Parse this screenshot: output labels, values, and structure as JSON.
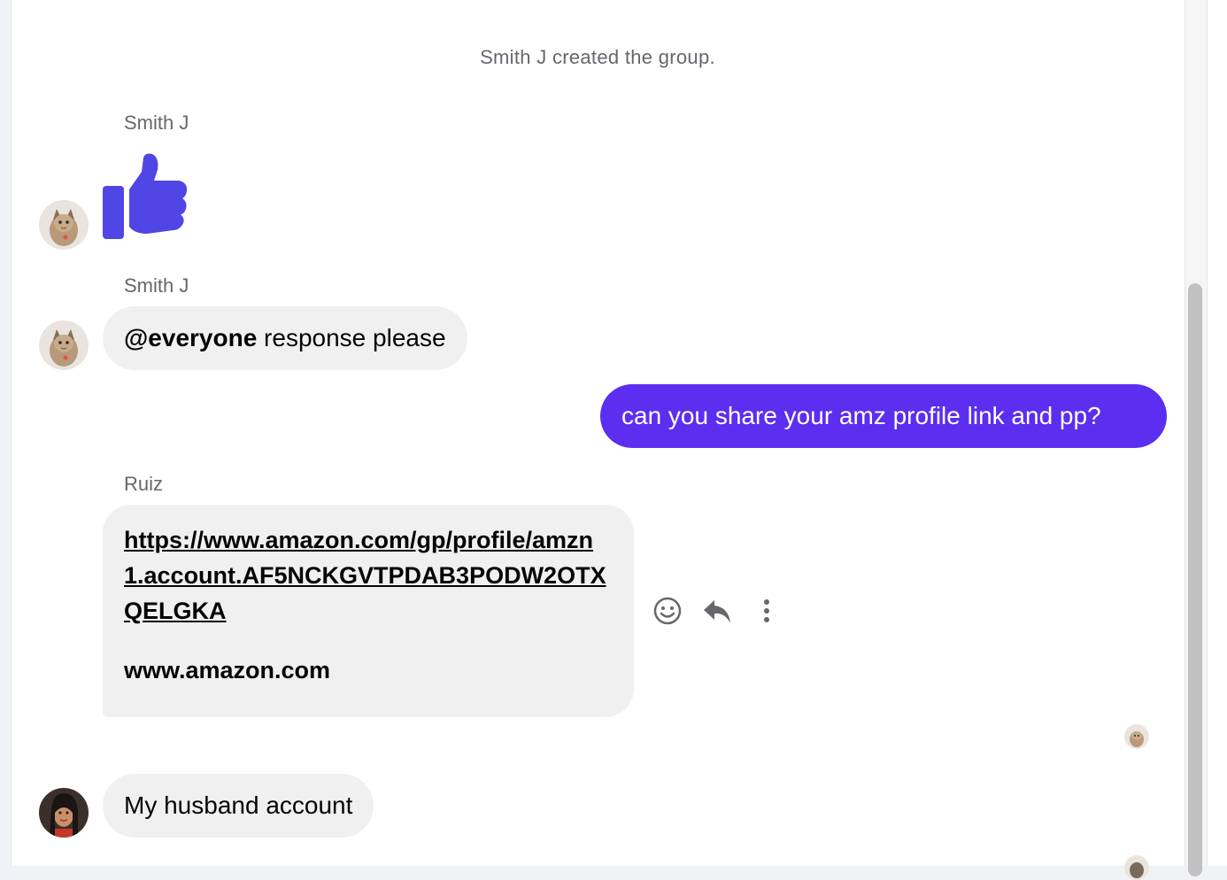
{
  "conversation": {
    "system_message": "Smith J created the group.",
    "messages": [
      {
        "sender": "Smith J",
        "type": "like-sticker"
      },
      {
        "sender": "Smith J",
        "mention": "@everyone",
        "text": " response please"
      },
      {
        "sender": "me",
        "text": "can you share your amz profile link and pp?"
      },
      {
        "sender": "Ruiz",
        "link": "https://www.amazon.com/gp/profile/amzn1.account.AF5NCKGVTPDAB3PODW2OTXQELGKA",
        "domain": "www.amazon.com"
      },
      {
        "sender": "",
        "text": "My husband account"
      }
    ]
  },
  "message_actions": {
    "react": "smiley-icon",
    "reply": "reply-icon",
    "more": "more-vertical-icon"
  },
  "colors": {
    "outgoing_bubble": "#5b2ef0",
    "incoming_bubble": "#f0f0f0",
    "like_sticker": "#5046e5",
    "secondary_text": "#65676b"
  }
}
